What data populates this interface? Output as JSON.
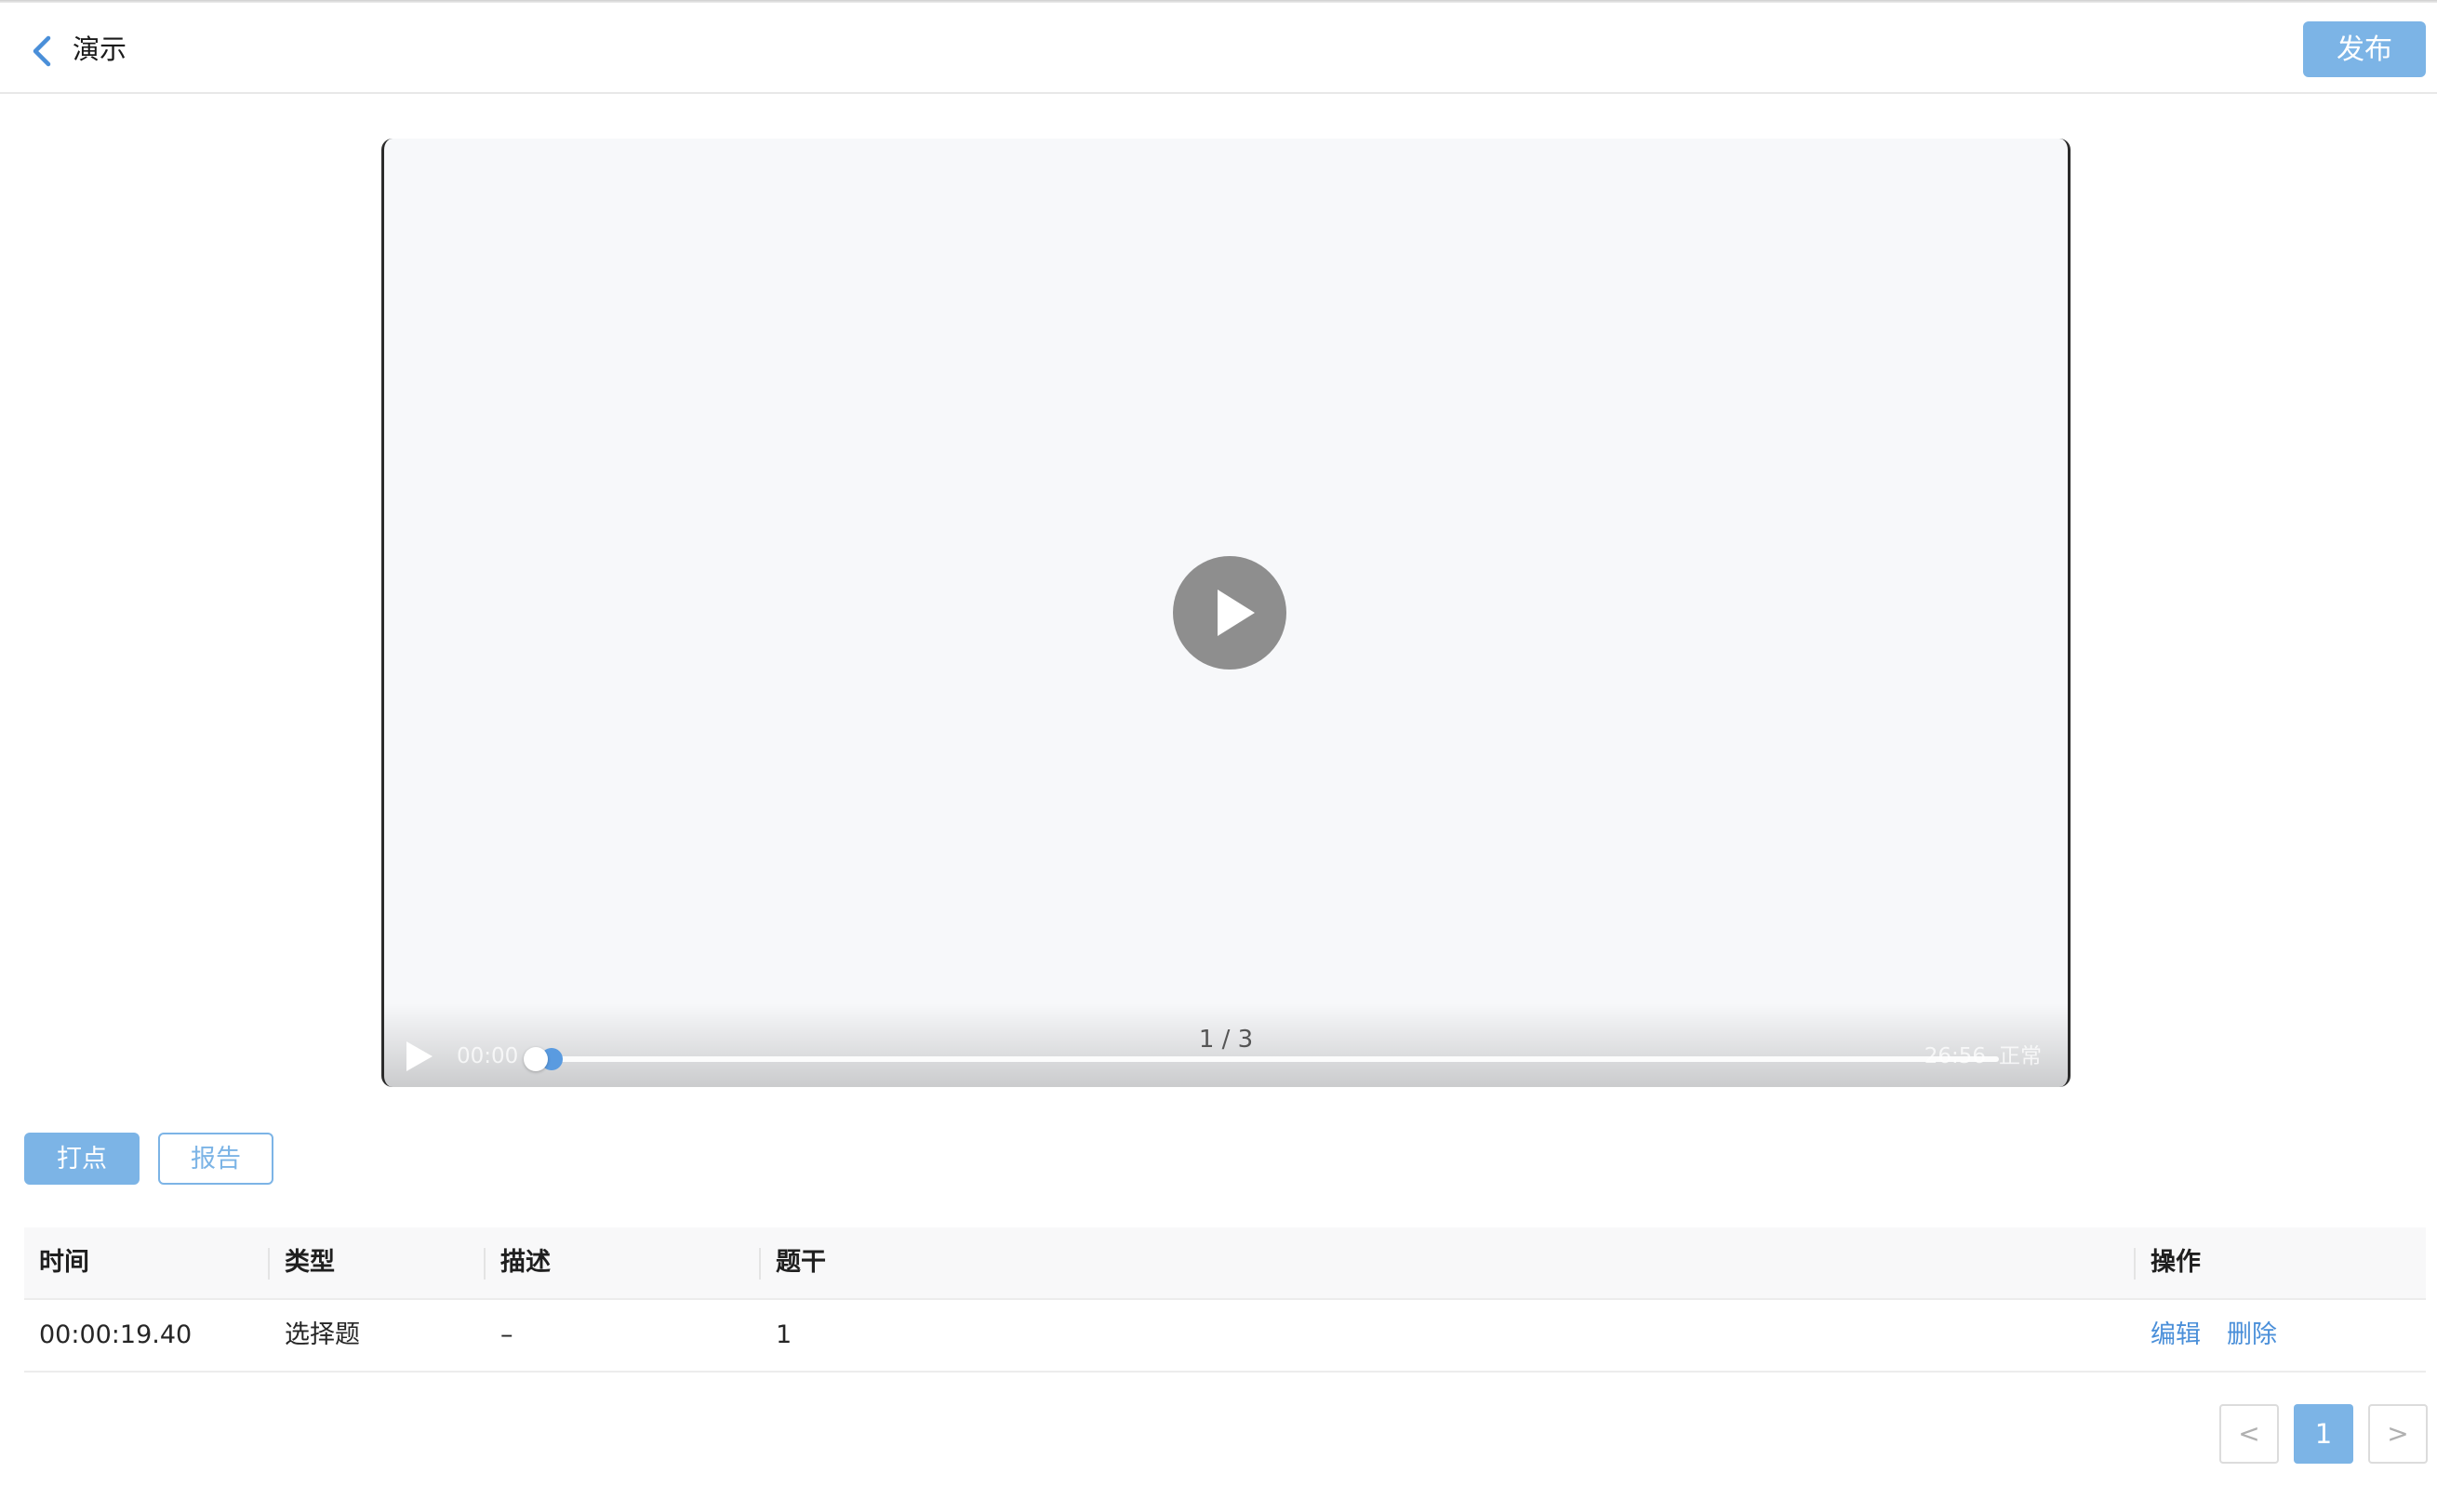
{
  "header": {
    "back_icon": "chevron-left-icon",
    "title": "演示",
    "publish_label": "发布"
  },
  "colors": {
    "accent": "#7cb4e6",
    "link": "#4a8fd9",
    "progress": "#5a9be0"
  },
  "player": {
    "current_time": "00:00",
    "total_time": "26:56",
    "page_indicator": "1 / 3",
    "speed_label": "正常",
    "progress_fraction": 0.0,
    "play_icon": "play-icon"
  },
  "actions": {
    "mark_label": "打点",
    "report_label": "报告"
  },
  "table": {
    "columns": [
      "时间",
      "类型",
      "描述",
      "题干",
      "操作"
    ],
    "rows": [
      {
        "time": "00:00:19.40",
        "type": "选择题",
        "description": "–",
        "stem": "1",
        "actions": [
          "编辑",
          "删除"
        ]
      }
    ]
  },
  "pagination": {
    "prev": "<",
    "current_page": "1",
    "next": ">"
  }
}
